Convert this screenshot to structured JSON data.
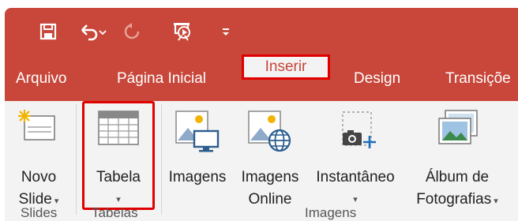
{
  "qat": {
    "save_icon": "save-icon",
    "undo_icon": "undo-icon",
    "redo_icon": "redo-icon",
    "present_icon": "start-from-beginning-icon",
    "customize_icon": "customize-qat-icon"
  },
  "tabs": [
    "Arquivo",
    "Página Inicial",
    "Inserir",
    "Design",
    "Transiçõe"
  ],
  "ribbon": {
    "buttons": [
      {
        "line1": "Novo",
        "line2": "Slide"
      },
      {
        "line1": "Tabela",
        "line2": ""
      },
      {
        "line1": "Imagens",
        "line2": ""
      },
      {
        "line1": "Imagens",
        "line2": "Online"
      },
      {
        "line1": "Instantâneo",
        "line2": ""
      },
      {
        "line1": "Álbum de",
        "line2": "Fotografias"
      }
    ],
    "groups": [
      "Slides",
      "Tabelas",
      "Imagens"
    ]
  },
  "colors": {
    "accent": "#c8473a",
    "highlight": "#e00000",
    "ribbon_bg": "#f3f3f3"
  }
}
